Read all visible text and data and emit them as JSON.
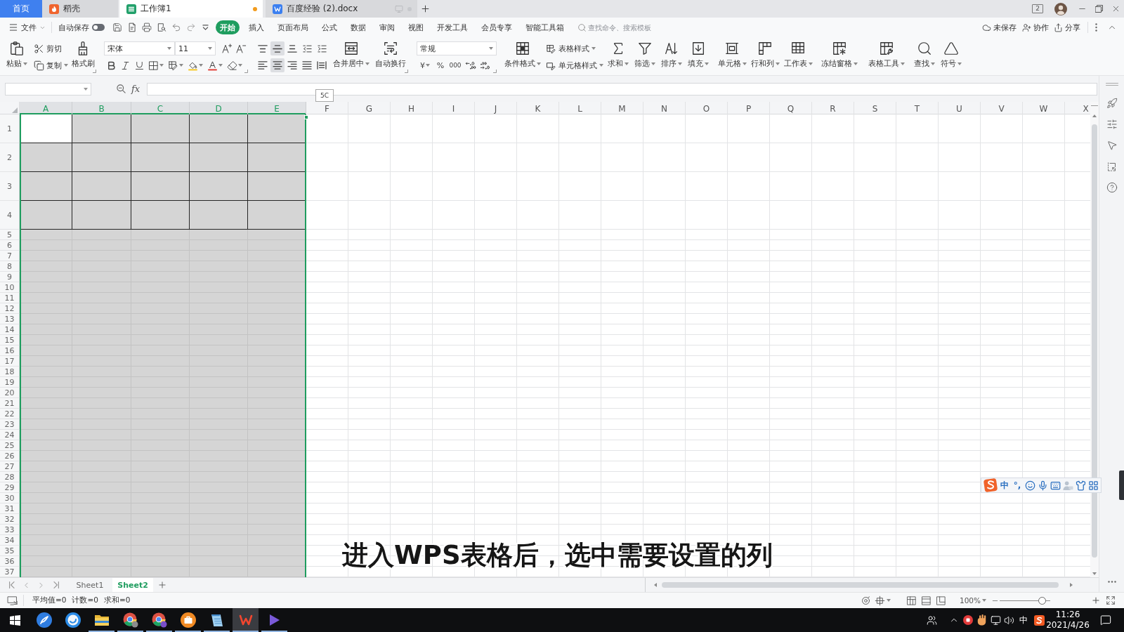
{
  "tab_bar": {
    "tabs": [
      {
        "kind": "home",
        "label": "首页",
        "selected": false
      },
      {
        "kind": "docer",
        "label": "稻壳",
        "selected": false
      },
      {
        "kind": "sheet",
        "label": "工作簿1",
        "selected": true,
        "unsaved": true
      },
      {
        "kind": "doc",
        "label": "百度经验 (2).docx",
        "selected": false,
        "unsaved": false
      }
    ],
    "tab_count": "2"
  },
  "menu_bar": {
    "file": "文件",
    "autosave": {
      "label": "自动保存",
      "on": false
    },
    "tabs": [
      {
        "label": "开始",
        "selected": true
      },
      {
        "label": "插入",
        "selected": false
      },
      {
        "label": "页面布局",
        "selected": false
      },
      {
        "label": "公式",
        "selected": false
      },
      {
        "label": "数据",
        "selected": false
      },
      {
        "label": "审阅",
        "selected": false
      },
      {
        "label": "视图",
        "selected": false
      },
      {
        "label": "开发工具",
        "selected": false
      },
      {
        "label": "会员专享",
        "selected": false
      },
      {
        "label": "智能工具箱",
        "selected": false
      }
    ],
    "search": {
      "placeholder": "查找命令、搜索模板"
    },
    "actions": [
      "未保存",
      "协作",
      "分享"
    ]
  },
  "ribbon": {
    "paste": "粘贴",
    "cut": "剪切",
    "copy": "复制",
    "format_painter": "格式刷",
    "font": "宋体",
    "font_size": "11",
    "vertical_align": [
      {
        "selected": false
      },
      {
        "selected": true
      },
      {
        "selected": false
      }
    ],
    "horizontal_align": [
      {
        "selected": false
      },
      {
        "selected": true
      },
      {
        "selected": false
      },
      {
        "selected": false
      },
      {
        "selected": false
      }
    ],
    "merge_center": "合并居中",
    "wrap_text": "自动换行",
    "number_format": "常规",
    "currency": "¥",
    "percent": "%",
    "thousands": "000",
    "conditional_format": "条件格式",
    "table_style": "表格样式",
    "cell_style": "单元格样式",
    "sum": "求和",
    "filter": "筛选",
    "sort": "排序",
    "fill": "填充",
    "cell": "单元格",
    "rows_columns": "行和列",
    "worksheet": "工作表",
    "freeze_panes": "冻结窗格",
    "table_tools": "表格工具",
    "find": "查找",
    "symbol": "符号"
  },
  "formula_bar": {
    "function_label": "fx"
  },
  "selection_tooltip": "5C",
  "sheet": {
    "columns": [
      {
        "label": "A",
        "selected": true
      },
      {
        "label": "B",
        "selected": true
      },
      {
        "label": "C",
        "selected": true
      },
      {
        "label": "D",
        "selected": true
      },
      {
        "label": "E",
        "selected": true
      },
      {
        "label": "F",
        "selected": false
      },
      {
        "label": "G",
        "selected": false
      },
      {
        "label": "H",
        "selected": false
      },
      {
        "label": "I",
        "selected": false
      },
      {
        "label": "J",
        "selected": false
      },
      {
        "label": "K",
        "selected": false
      },
      {
        "label": "L",
        "selected": false
      },
      {
        "label": "M",
        "selected": false
      },
      {
        "label": "N",
        "selected": false
      },
      {
        "label": "O",
        "selected": false
      },
      {
        "label": "P",
        "selected": false
      },
      {
        "label": "Q",
        "selected": false
      },
      {
        "label": "R",
        "selected": false
      },
      {
        "label": "S",
        "selected": false
      },
      {
        "label": "T",
        "selected": false
      },
      {
        "label": "U",
        "selected": false
      },
      {
        "label": "V",
        "selected": false
      },
      {
        "label": "W",
        "selected": false
      },
      {
        "label": "X",
        "selected": false
      }
    ],
    "rows": [
      "1",
      "2",
      "3",
      "4",
      "5",
      "6",
      "7",
      "8",
      "9",
      "10",
      "11",
      "12",
      "13",
      "14",
      "15",
      "16",
      "17",
      "18",
      "19",
      "20",
      "21",
      "22",
      "23",
      "24",
      "25",
      "26",
      "27",
      "28",
      "29",
      "30",
      "31",
      "32",
      "33",
      "34",
      "35",
      "36",
      "37"
    ],
    "table": [
      [
        {
          "active": true
        },
        {
          "active": false
        },
        {
          "active": false
        },
        {
          "active": false
        },
        {
          "active": false
        }
      ],
      [
        {
          "active": false
        },
        {
          "active": false
        },
        {
          "active": false
        },
        {
          "active": false
        },
        {
          "active": false
        }
      ],
      [
        {
          "active": false
        },
        {
          "active": false
        },
        {
          "active": false
        },
        {
          "active": false
        },
        {
          "active": false
        }
      ],
      [
        {
          "active": false
        },
        {
          "active": false
        },
        {
          "active": false
        },
        {
          "active": false
        },
        {
          "active": false
        }
      ]
    ]
  },
  "caption": "进入WPS表格后，选中需要设置的列",
  "sheet_tabs": [
    {
      "label": "Sheet1",
      "selected": false
    },
    {
      "label": "Sheet2",
      "selected": true
    }
  ],
  "status_bar": {
    "stats": [
      "平均值=0",
      "计数=0",
      "求和=0"
    ],
    "zoom": {
      "label": "100%",
      "level": 0.9
    }
  },
  "ime_bar": {
    "mode": "中",
    "punctuation": "°,"
  },
  "taskbar": {
    "apps": [
      {
        "running": false,
        "selected": false
      },
      {
        "running": false,
        "selected": false
      },
      {
        "running": true,
        "selected": false
      },
      {
        "running": true,
        "selected": false
      },
      {
        "running": true,
        "selected": false
      },
      {
        "running": true,
        "selected": false
      },
      {
        "running": true,
        "selected": false
      },
      {
        "running": true,
        "selected": true
      },
      {
        "running": true,
        "selected": false
      }
    ],
    "input_mode": "中",
    "time": "11:26",
    "date": "2021/4/26"
  }
}
